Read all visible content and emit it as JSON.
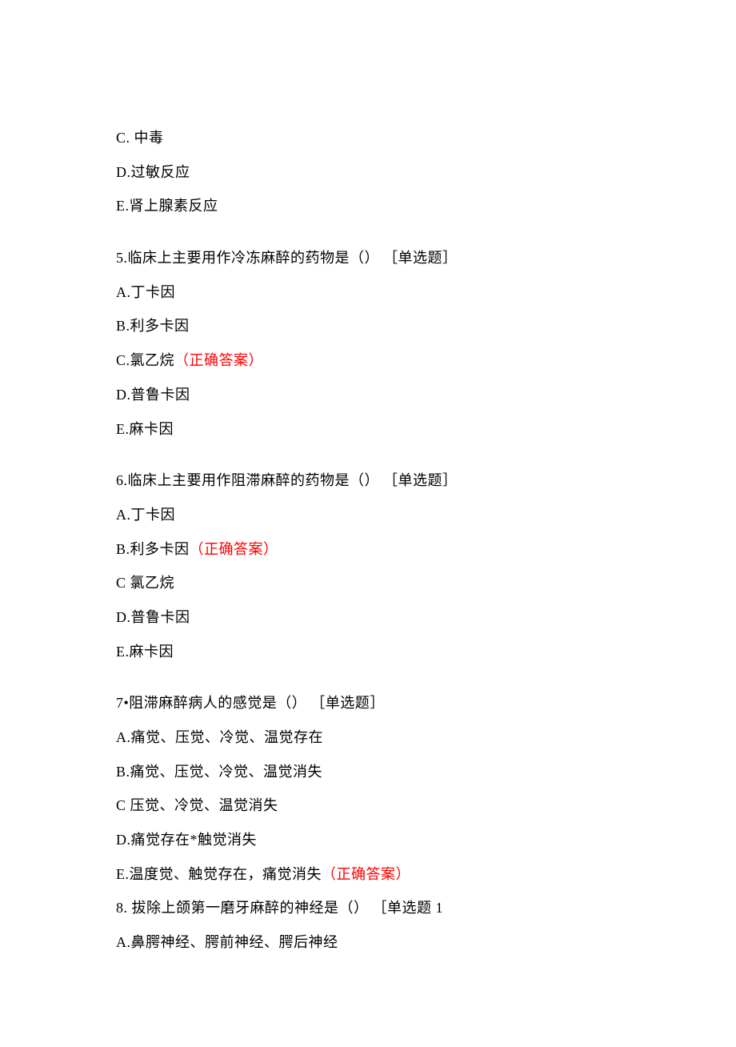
{
  "correctLabel": "（正确答案）",
  "q4tail": {
    "optC": "C. 中毒",
    "optD": "D.过敏反应",
    "optE": "E.肾上腺素反应"
  },
  "q5": {
    "stem": "5.临床上主要用作冷冻麻醉的药物是（） ［单选题］",
    "optA": "A.丁卡因",
    "optB": "B.利多卡因",
    "optC": "C.氯乙烷",
    "optD": "D.普鲁卡因",
    "optE": "E.麻卡因"
  },
  "q6": {
    "stem": "6.临床上主要用作阻滞麻醉的药物是（） ［单选题］",
    "optA": "A.丁卡因",
    "optB": "B.利多卡因",
    "optC": "C 氯乙烷",
    "optD": "D.普鲁卡因",
    "optE": "E.麻卡因"
  },
  "q7": {
    "stem": "7•阻滞麻醉病人的感觉是（） ［单选题］",
    "optA": "A.痛觉、压觉、冷觉、温觉存在",
    "optB": "B.痛觉、压觉、冷觉、温觉消失",
    "optC": "C 压觉、冷觉、温觉消失",
    "optD": "D.痛觉存在*触觉消失",
    "optE": "E.温度觉、触觉存在，痛觉消失"
  },
  "q8": {
    "stem": "8. 拔除上颌第一磨牙麻醉的神经是（） ［单选题 1",
    "optA": "A.鼻腭神经、腭前神经、腭后神经"
  }
}
